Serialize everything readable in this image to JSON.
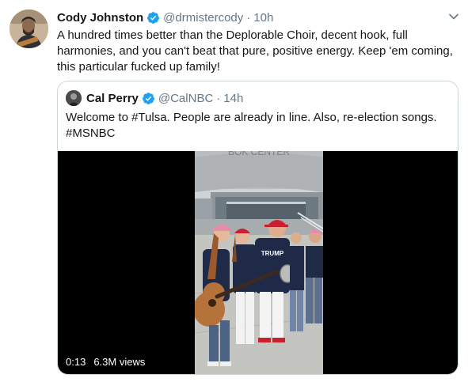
{
  "tweet": {
    "author_name": "Cody Johnston",
    "author_handle": "@drmistercody",
    "separator": "·",
    "time": "10h",
    "text": "A hundred times better than the Deplorable Choir, decent hook, full harmonies, and you can't beat that pure, positive energy. Keep 'em coming, this particular fucked up family!"
  },
  "quoted": {
    "author_name": "Cal Perry",
    "author_handle": "@CalNBC",
    "separator": "·",
    "time": "14h",
    "text": "Welcome to #Tulsa. People are already in line. Also, re-election songs. #MSNBC",
    "video": {
      "duration": "0:13",
      "views": "6.3M views",
      "sign_text": "BOK CENTER",
      "shirt_text": "TRUMP"
    }
  },
  "colors": {
    "verified": "#1da1f2",
    "secondary_text": "#657786",
    "border": "#ccd6dd",
    "hat_pink": "#e98aa8",
    "hat_red": "#c8202f"
  },
  "icons": {
    "verified": "verified-badge-icon",
    "caret": "chevron-down-icon"
  }
}
